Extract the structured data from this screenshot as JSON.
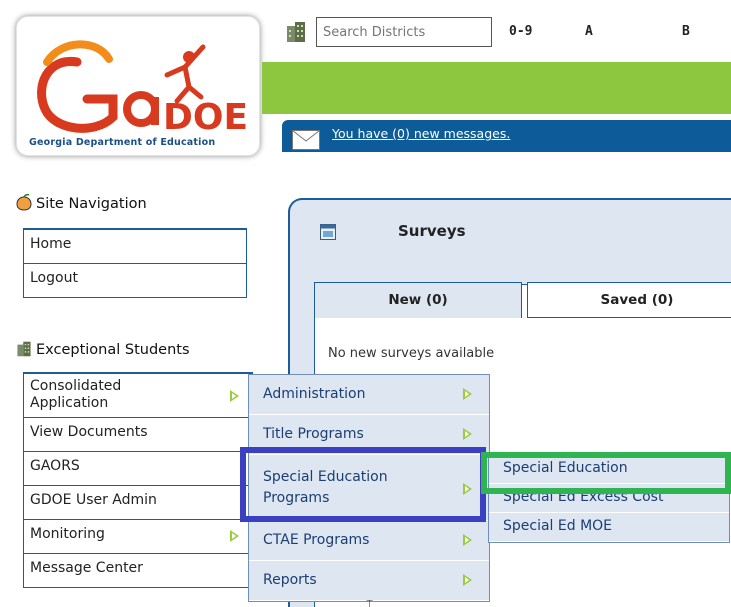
{
  "header": {
    "logo_caption": "Georgia Department of Education",
    "logo_text": "GaDOE",
    "search_placeholder": "Search Districts",
    "letters": [
      "0-9",
      "A",
      "B"
    ],
    "messages_link": "You have (0) new messages."
  },
  "sidebar": {
    "site_nav_heading": "Site Navigation",
    "site_nav_items": [
      {
        "label": "Home"
      },
      {
        "label": "Logout"
      }
    ],
    "exceptional_heading": "Exceptional Students",
    "exceptional_items": [
      {
        "label": "Consolidated Application",
        "has_submenu": true
      },
      {
        "label": "View Documents",
        "has_submenu": false
      },
      {
        "label": "GAORS",
        "has_submenu": false
      },
      {
        "label": "GDOE User Admin",
        "has_submenu": false
      },
      {
        "label": "Monitoring",
        "has_submenu": true
      },
      {
        "label": "Message Center",
        "has_submenu": false
      }
    ]
  },
  "surveys": {
    "title": "Surveys",
    "tabs": [
      {
        "label": "New (0)",
        "active": true
      },
      {
        "label": "Saved (0)",
        "active": false
      }
    ],
    "empty_message": "No new surveys available"
  },
  "flyout_menu": {
    "items": [
      {
        "label": "Administration",
        "has_submenu": true
      },
      {
        "label": "Title Programs",
        "has_submenu": true
      },
      {
        "label": "Special Education Programs",
        "has_submenu": true
      },
      {
        "label": "CTAE Programs",
        "has_submenu": true
      },
      {
        "label": "Reports",
        "has_submenu": true
      }
    ]
  },
  "submenu": {
    "items": [
      {
        "label": "Special Education"
      },
      {
        "label": "Special Ed Excess Cost"
      },
      {
        "label": "Special Ed MOE"
      }
    ]
  },
  "colors": {
    "green_bar": "#8dc63f",
    "blue_bar": "#0d5c99",
    "highlight_blue": "#3b3fc2",
    "highlight_green": "#2fb452",
    "menu_bg": "#dde6f1"
  },
  "icons": [
    "building-icon",
    "envelope-icon",
    "peach-icon",
    "surveys-icon",
    "submenu-arrow-icon"
  ]
}
